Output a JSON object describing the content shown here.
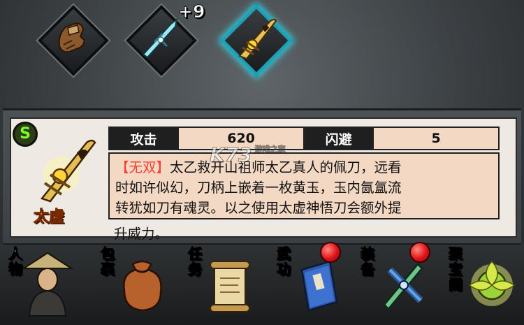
{
  "equipment_slots": [
    {
      "name": "gloves-icon",
      "upgrade": ""
    },
    {
      "name": "jade-sword-icon",
      "upgrade": "+9"
    },
    {
      "name": "golden-blade-icon",
      "upgrade": "",
      "selected": true
    }
  ],
  "item": {
    "grade": "S",
    "name": "太虚",
    "stats": [
      {
        "label": "攻击",
        "value": "620"
      },
      {
        "label": "闪避",
        "value": "5"
      }
    ],
    "tag": "【无双】",
    "description_lines": [
      "太乙救开山祖师太乙真人的佩刀，远看",
      "时如许似幻，刀柄上嵌着一枚黄玉，玉内氤氲流",
      "转犹如刀有魂灵。以之使用太虚神悟刀会额外提"
    ],
    "overflow_line": "升威力。"
  },
  "watermark": {
    "text": "K73",
    "sub": "游戏之家"
  },
  "nav": [
    {
      "label": "人物",
      "icon": "character-icon",
      "badge": false
    },
    {
      "label": "包裹",
      "icon": "bag-icon",
      "badge": false
    },
    {
      "label": "任务",
      "icon": "scroll-icon",
      "badge": false
    },
    {
      "label": "武功",
      "icon": "book-icon",
      "badge": true
    },
    {
      "label": "装备",
      "icon": "equipment-icon",
      "badge": true
    },
    {
      "label": "聚宝阁",
      "icon": "treasure-icon",
      "badge": false
    }
  ],
  "colors": {
    "accent_tag": "#ff3b2f",
    "grade": "#7dff2a",
    "item_name": "#ffe14a",
    "selected_glow": "#3ad3e6",
    "badge": "#e0121b"
  }
}
